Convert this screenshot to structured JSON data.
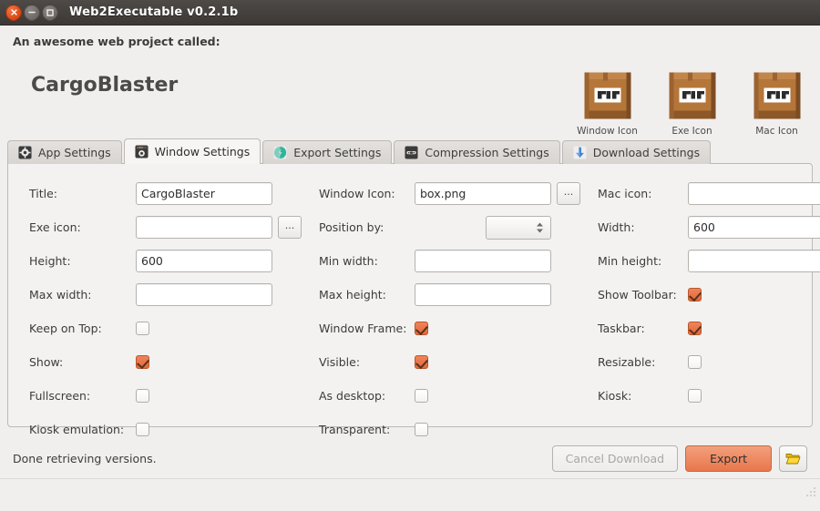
{
  "window": {
    "title": "Web2Executable v0.2.1b",
    "controls": {
      "close": "close-button",
      "minimize": "minimize-button",
      "maximize": "maximize-button"
    }
  },
  "header": {
    "subtitle": "An awesome web project called:",
    "project_name": "CargoBlaster",
    "icon_previews": [
      {
        "caption": "Window Icon"
      },
      {
        "caption": "Exe Icon"
      },
      {
        "caption": "Mac Icon"
      }
    ]
  },
  "tabs": [
    {
      "label": "App Settings",
      "icon": "gear-icon",
      "active": false
    },
    {
      "label": "Window Settings",
      "icon": "window-icon",
      "active": true
    },
    {
      "label": "Export Settings",
      "icon": "export-icon",
      "active": false
    },
    {
      "label": "Compression Settings",
      "icon": "compression-icon",
      "active": false
    },
    {
      "label": "Download Settings",
      "icon": "download-icon",
      "active": false
    }
  ],
  "form": {
    "rows": [
      {
        "c1": {
          "label": "Title:",
          "type": "text",
          "value": "CargoBlaster",
          "placeholder": ""
        },
        "c2": {
          "label": "Window Icon:",
          "type": "text-browse",
          "value": "box.png",
          "placeholder": "",
          "browse_label": "..."
        },
        "c3": {
          "label": "Mac icon:",
          "type": "text-browse",
          "value": "",
          "placeholder": "",
          "browse_label": "..."
        }
      },
      {
        "c1": {
          "label": "Exe icon:",
          "type": "text-browse",
          "value": "",
          "placeholder": "",
          "browse_label": "..."
        },
        "c2": {
          "label": "Position by:",
          "type": "spinner",
          "value": ""
        },
        "c3": {
          "label": "Width:",
          "type": "text",
          "value": "600",
          "placeholder": ""
        }
      },
      {
        "c1": {
          "label": "Height:",
          "type": "text",
          "value": "600",
          "placeholder": ""
        },
        "c2": {
          "label": "Min width:",
          "type": "text",
          "value": "",
          "placeholder": ""
        },
        "c3": {
          "label": "Min height:",
          "type": "text",
          "value": "",
          "placeholder": ""
        }
      },
      {
        "c1": {
          "label": "Max width:",
          "type": "text",
          "value": "",
          "placeholder": ""
        },
        "c2": {
          "label": "Max height:",
          "type": "text",
          "value": "",
          "placeholder": ""
        },
        "c3": {
          "label": "Show Toolbar:",
          "type": "checkbox",
          "checked": true
        }
      },
      {
        "c1": {
          "label": "Keep on Top:",
          "type": "checkbox",
          "checked": false
        },
        "c2": {
          "label": "Window Frame:",
          "type": "checkbox",
          "checked": true
        },
        "c3": {
          "label": "Taskbar:",
          "type": "checkbox",
          "checked": true
        }
      },
      {
        "c1": {
          "label": "Show:",
          "type": "checkbox",
          "checked": true
        },
        "c2": {
          "label": "Visible:",
          "type": "checkbox",
          "checked": true
        },
        "c3": {
          "label": "Resizable:",
          "type": "checkbox",
          "checked": false
        }
      },
      {
        "c1": {
          "label": "Fullscreen:",
          "type": "checkbox",
          "checked": false
        },
        "c2": {
          "label": "As desktop:",
          "type": "checkbox",
          "checked": false
        },
        "c3": {
          "label": "Kiosk:",
          "type": "checkbox",
          "checked": false
        }
      },
      {
        "c1": {
          "label": "Kiosk emulation:",
          "type": "checkbox",
          "checked": false
        },
        "c2": {
          "label": "Transparent:",
          "type": "checkbox",
          "checked": false
        },
        "c3": {
          "label": "",
          "type": "empty"
        }
      }
    ]
  },
  "footer": {
    "status": "Done retrieving versions.",
    "cancel_label": "Cancel Download",
    "cancel_disabled": true,
    "export_label": "Export",
    "open_folder_icon": "folder-open-icon"
  },
  "colors": {
    "accent_orange": "#e9764c",
    "checkbox_on": "#e2683c",
    "window_bg": "#f0efee",
    "panel_bg": "#f3f2f1",
    "titlebar": "#3c3835",
    "box_icon_brown": "#b5763a",
    "folder_yellow": "#f2c40f"
  }
}
